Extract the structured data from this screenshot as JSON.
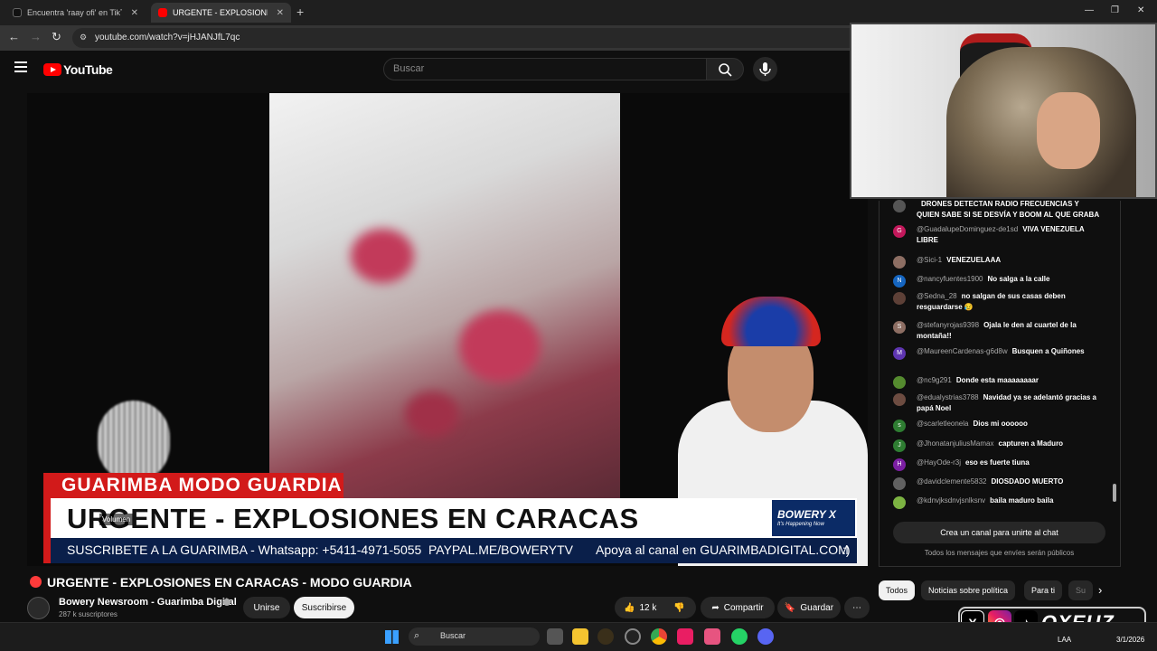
{
  "browser": {
    "tabs": [
      {
        "label": "Encuentra 'raay ofi' en TikTok |",
        "active": false
      },
      {
        "label": "URGENTE - EXPLOSIONES E",
        "active": true
      }
    ],
    "url": "youtube.com/watch?v=jHJANJfL7qc"
  },
  "youtube": {
    "brand": "YouTube",
    "search_placeholder": "Buscar"
  },
  "video": {
    "lower_third_top": "GUARIMBA MODO GUARDIA",
    "lower_third_main": "URGENTE - EXPLOSIONES EN CARACAS",
    "brand_box": {
      "name": "BOWERY X",
      "tagline": "It's Happening Now"
    },
    "ticker": [
      "SUSCRIBETE A LA GUARIMBA - Whatsapp: +5411-4971-5055",
      "PAYPAL.ME/BOWERYTV",
      "Apoya al canal en GUARIMBADIGITAL.COM",
      ":)"
    ],
    "volume_tooltip": "Volumen",
    "title": "URGENTE - EXPLOSIONES EN CARACAS - MODO GUARDIA",
    "channel": "Bowery Newsroom - Guarimba Digital",
    "subscribers": "287 k suscriptores",
    "join_label": "Unirse",
    "subscribe_label": "Suscribirse",
    "likes": "12 k",
    "share_label": "Compartir",
    "save_label": "Guardar"
  },
  "chat": {
    "messages": [
      {
        "author": "",
        "text": "DRONES DETECTAN RADIO FRECUENCIAS Y QUIEN SABE SI SE DESVÍA Y BOOM AL QUE GRABA",
        "avatar": "",
        "color": "#555555"
      },
      {
        "author": "@GuadalupeDominguez-de1sd",
        "text": "VIVA VENEZUELA LIBRE",
        "avatar": "G",
        "color": "#c2185b"
      },
      {
        "author": "@Sici-1",
        "text": "VENEZUELAAA",
        "avatar": "",
        "color": "#8d6e63"
      },
      {
        "author": "@nancyfuentes1900",
        "text": "No salga a la calle",
        "avatar": "N",
        "color": "#1565c0"
      },
      {
        "author": "@Sedna_28",
        "text": "no salgan de sus casas deben resguardarse 😥",
        "avatar": "",
        "color": "#5d4037"
      },
      {
        "author": "@stefanyrojas9398",
        "text": "Ojala le den al cuartel de la montaña!!",
        "avatar": "S",
        "color": "#8d6e63"
      },
      {
        "author": "@MaureenCardenas-g6d8w",
        "text": "Busquen a Quiñones",
        "avatar": "M",
        "color": "#5e35b1"
      },
      {
        "author": "@nc9g291",
        "text": "Donde esta maaaaaaaar",
        "avatar": "",
        "color": "#558b2f"
      },
      {
        "author": "@edualystrias3788",
        "text": "Navidad ya se adelantó gracias a papá Noel",
        "avatar": "",
        "color": "#6d4c41"
      },
      {
        "author": "@scarletleonela",
        "text": "Dios mi oooooo",
        "avatar": "s",
        "color": "#2e7d32"
      },
      {
        "author": "@JhonatanjuliusMamax",
        "text": "capturen a Maduro",
        "avatar": "J",
        "color": "#2e7d32"
      },
      {
        "author": "@HayOde-r3j",
        "text": "eso es fuerte tiuna",
        "avatar": "H",
        "color": "#7b1fa2"
      },
      {
        "author": "@davidclemente5832",
        "text": "DIOSDADO MUERTO",
        "avatar": "",
        "color": "#616161"
      },
      {
        "author": "@kdnvjksdnvjsnlksnv",
        "text": "baila maduro baila",
        "avatar": "",
        "color": "#7cb342"
      }
    ],
    "create_channel": "Crea un canal para unirte al chat",
    "public_note": "Todos los mensajes que envíes serán públicos",
    "chips": [
      "Todos",
      "Noticias sobre política",
      "Para ti",
      "Su"
    ]
  },
  "taskbar": {
    "search_label": "Buscar",
    "lang": "LAA",
    "date": "3/1/2026"
  },
  "overlay": {
    "brand": "OXEUZ"
  }
}
